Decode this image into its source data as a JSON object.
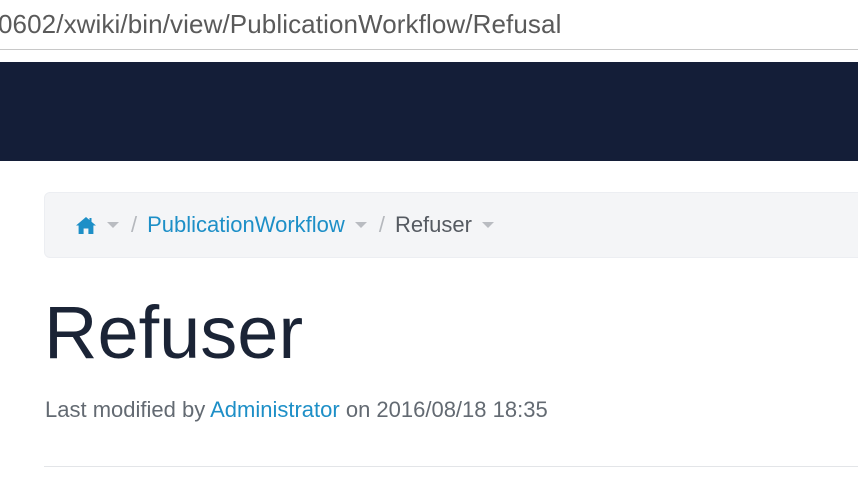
{
  "browser": {
    "url": "0602/xwiki/bin/view/PublicationWorkflow/Refusal"
  },
  "breadcrumb": {
    "home_icon": "home-icon",
    "items": [
      {
        "label": "PublicationWorkflow"
      },
      {
        "label": "Refuser"
      }
    ],
    "separator": "/"
  },
  "page": {
    "title": "Refuser",
    "meta_prefix": "Last modified by",
    "author": "Administrator",
    "meta_suffix": "on 2016/08/18 18:35"
  },
  "colors": {
    "navbar": "#141e38",
    "link": "#1d8fc7",
    "title": "#1b2436",
    "breadcrumb_bg": "#f4f5f7"
  }
}
